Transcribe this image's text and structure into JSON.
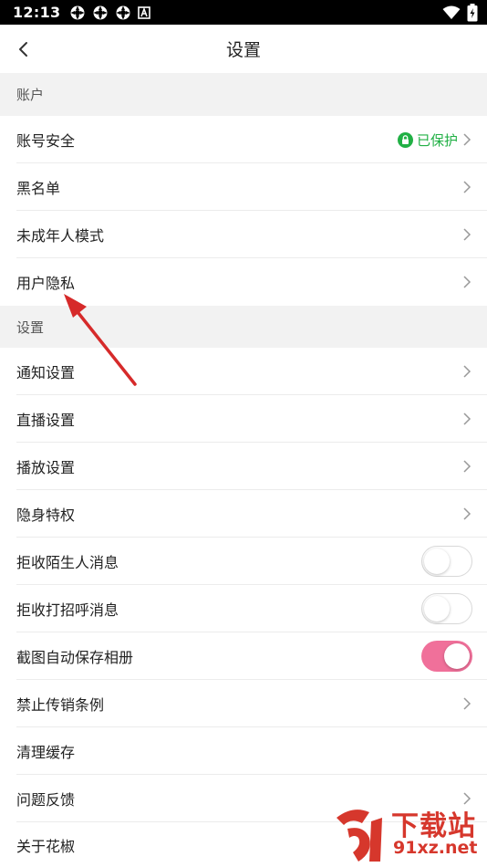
{
  "status_bar": {
    "time": "12:13",
    "left_icons": [
      "notification-icon",
      "notification-icon",
      "notification-icon",
      "a-icon"
    ],
    "right_icons": [
      "wifi-icon",
      "battery-icon"
    ]
  },
  "header": {
    "title": "设置",
    "back_icon": "chevron-left-icon"
  },
  "sections": {
    "account": {
      "title": "账户",
      "items": [
        {
          "label": "账号安全",
          "status": "已保护"
        },
        {
          "label": "黑名单"
        },
        {
          "label": "未成年人模式"
        },
        {
          "label": "用户隐私"
        }
      ]
    },
    "settings": {
      "title": "设置",
      "items": [
        {
          "label": "通知设置"
        },
        {
          "label": "直播设置"
        },
        {
          "label": "播放设置"
        },
        {
          "label": "隐身特权"
        },
        {
          "label": "拒收陌生人消息",
          "toggle": false
        },
        {
          "label": "拒收打招呼消息",
          "toggle": false
        },
        {
          "label": "截图自动保存相册",
          "toggle": true
        },
        {
          "label": "禁止传销条例"
        },
        {
          "label": "清理缓存"
        },
        {
          "label": "问题反馈"
        },
        {
          "label": "关于花椒"
        }
      ]
    }
  },
  "colors": {
    "protected_green": "#21b045",
    "toggle_on_pink": "#f0709a",
    "annotation_red": "#d62a2a"
  },
  "watermark": {
    "line1": "下载站",
    "line2": "91xz.net"
  }
}
